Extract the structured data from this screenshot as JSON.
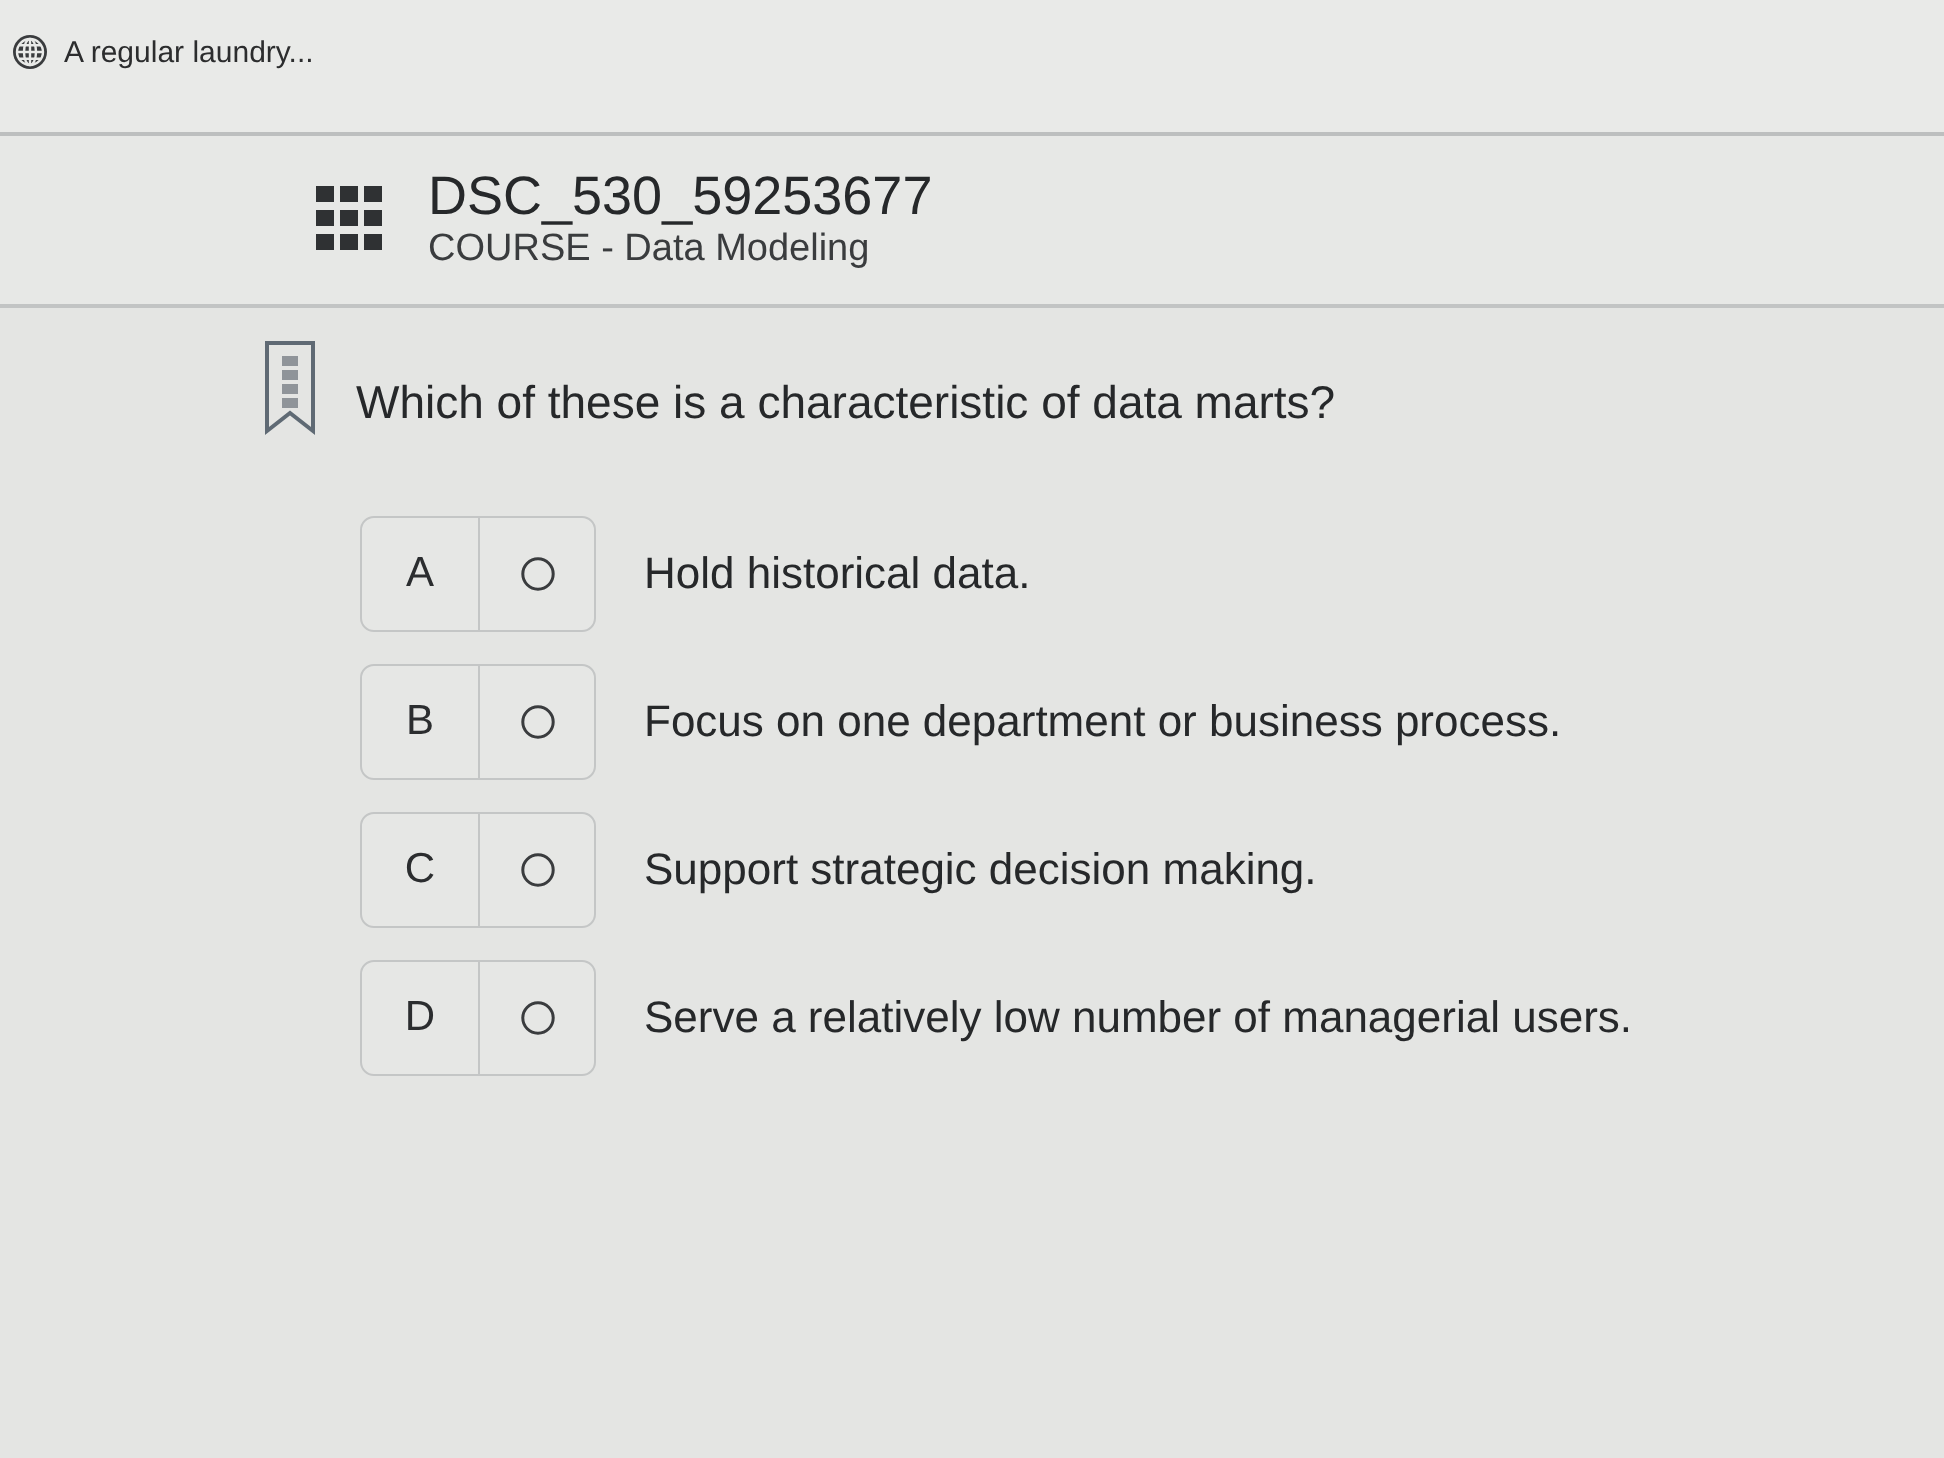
{
  "top_bar": {
    "title": "A regular laundry..."
  },
  "course": {
    "code": "DSC_530_59253677",
    "subtitle": "COURSE - Data Modeling"
  },
  "question": {
    "text": "Which of these is a characteristic of data marts?",
    "bookmarked": false
  },
  "options": [
    {
      "letter": "A",
      "text": "Hold historical data.",
      "selected": false
    },
    {
      "letter": "B",
      "text": "Focus on one department or business process.",
      "selected": false
    },
    {
      "letter": "C",
      "text": "Support strategic decision making.",
      "selected": false
    },
    {
      "letter": "D",
      "text": "Serve a relatively low number of managerial users.",
      "selected": false
    }
  ]
}
